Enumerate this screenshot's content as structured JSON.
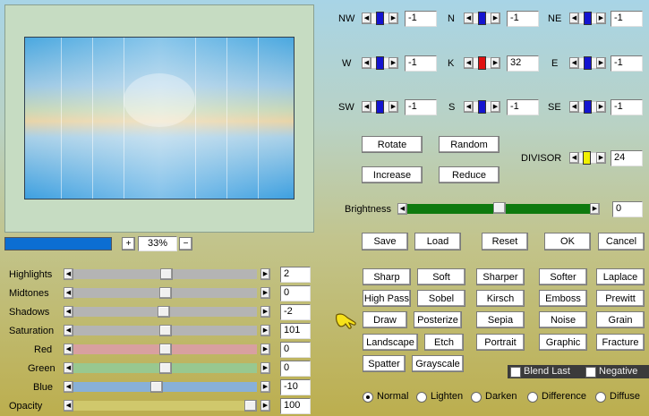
{
  "preview": {
    "zoom": "33%",
    "zoom_in": "+",
    "zoom_out": "−"
  },
  "matrix": [
    {
      "id": "nw",
      "label": "NW",
      "value": "-1",
      "color": "#1414d0",
      "pos": 0.5
    },
    {
      "id": "n",
      "label": "N",
      "value": "-1",
      "color": "#1414d0",
      "pos": 0.5
    },
    {
      "id": "ne",
      "label": "NE",
      "value": "-1",
      "color": "#1414d0",
      "pos": 0.5
    },
    {
      "id": "w",
      "label": "W",
      "value": "-1",
      "color": "#1414d0",
      "pos": 0.5
    },
    {
      "id": "k",
      "label": "K",
      "value": "32",
      "color": "#e01010",
      "pos": 0.5
    },
    {
      "id": "e",
      "label": "E",
      "value": "-1",
      "color": "#1414d0",
      "pos": 0.5
    },
    {
      "id": "sw",
      "label": "SW",
      "value": "-1",
      "color": "#1414d0",
      "pos": 0.5
    },
    {
      "id": "s",
      "label": "S",
      "value": "-1",
      "color": "#1414d0",
      "pos": 0.5
    },
    {
      "id": "se",
      "label": "SE",
      "value": "-1",
      "color": "#1414d0",
      "pos": 0.5
    }
  ],
  "actions": {
    "rotate": "Rotate",
    "random": "Random",
    "increase": "Increase",
    "reduce": "Reduce"
  },
  "divisor": {
    "label": "DIVISOR",
    "value": "24",
    "color": "#f0f000"
  },
  "brightness": {
    "label": "Brightness",
    "value": "0",
    "pos": 0.5
  },
  "dialog": {
    "save": "Save",
    "load": "Load",
    "reset": "Reset",
    "ok": "OK",
    "cancel": "Cancel"
  },
  "adjustments": [
    {
      "id": "highlights",
      "label": "Highlights",
      "value": "2",
      "track": "#b4b4b4",
      "pos": 0.5
    },
    {
      "id": "midtones",
      "label": "Midtones",
      "value": "0",
      "track": "#b4b4b4",
      "pos": 0.5
    },
    {
      "id": "shadows",
      "label": "Shadows",
      "value": "-2",
      "track": "#b4b4b4",
      "pos": 0.5
    },
    {
      "id": "saturation",
      "label": "Saturation",
      "value": "101",
      "track": "#b4b4b4",
      "pos": 0.5
    },
    {
      "id": "red",
      "label": "Red",
      "value": "0",
      "track": "#d8a0a0",
      "pos": 0.5
    },
    {
      "id": "green",
      "label": "Green",
      "value": "0",
      "track": "#98c890",
      "pos": 0.5
    },
    {
      "id": "blue",
      "label": "Blue",
      "value": "-10",
      "track": "#88b0d8",
      "pos": 0.5
    },
    {
      "id": "opacity",
      "label": "Opacity",
      "value": "100",
      "track": "#d0c86c",
      "pos": 1
    }
  ],
  "presets": [
    [
      "Sharp",
      "Soft",
      "Sharper",
      "Softer",
      "Laplace"
    ],
    [
      "High Pass",
      "Sobel",
      "Kirsch",
      "Emboss",
      "Prewitt"
    ],
    [
      "Draw",
      "Posterize",
      "Sepia",
      "Noise",
      "Grain"
    ],
    [
      "Landscape",
      "Etch",
      "Portrait",
      "Graphic",
      "Fracture"
    ],
    [
      "Spatter",
      "Grayscale"
    ]
  ],
  "options": {
    "blend_last": "Blend Last",
    "negative": "Negative"
  },
  "blend_modes": [
    "Normal",
    "Lighten",
    "Darken",
    "Difference",
    "Diffuse"
  ],
  "selected_blend": "Normal"
}
